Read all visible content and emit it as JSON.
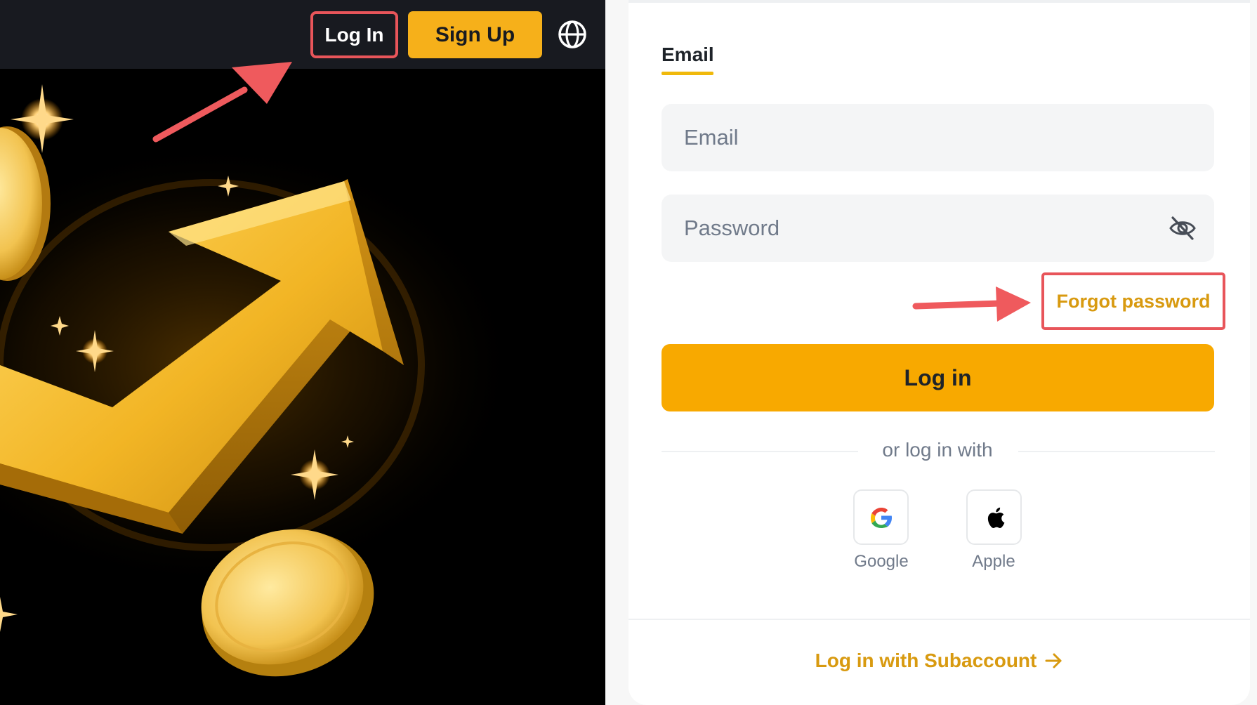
{
  "header": {
    "login_label": "Log In",
    "signup_label": "Sign Up",
    "globe_icon": "globe-icon"
  },
  "form": {
    "tab_label": "Email",
    "email_placeholder": "Email",
    "password_placeholder": "Password",
    "eye_icon": "eye-off-icon",
    "forgot_label": "Forgot password",
    "submit_label": "Log in",
    "alt_login_text": "or log in with",
    "social": [
      {
        "label": "Google",
        "icon": "google-icon"
      },
      {
        "label": "Apple",
        "icon": "apple-icon"
      }
    ],
    "subaccount_label": "Log in with Subaccount",
    "subaccount_icon": "arrow-right-icon"
  },
  "colors": {
    "accent": "#f0b90b",
    "button_yellow": "#f8a900",
    "link_gold": "#d89a10",
    "highlight_red": "#e8555a",
    "dark_bg": "#181a20"
  }
}
